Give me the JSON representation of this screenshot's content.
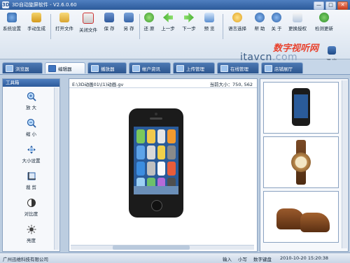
{
  "window": {
    "title": "3D自动旋屏软件 - V2.6.0.60",
    "min": "—",
    "max": "□",
    "close": "✕"
  },
  "toolbar": {
    "items": [
      {
        "label": "系统设置",
        "icon": "system-settings-icon"
      },
      {
        "label": "手动生成",
        "icon": "manual-generate-icon"
      },
      {
        "label": "打开文件",
        "icon": "open-file-icon"
      },
      {
        "label": "关闭文件",
        "icon": "close-file-icon"
      },
      {
        "label": "保",
        "icon": "save-icon"
      },
      {
        "label": "存",
        "icon": "save-icon"
      },
      {
        "label": "另",
        "icon": "save-as-icon"
      },
      {
        "label": "存",
        "icon": "save-as-icon"
      },
      {
        "label": "还",
        "icon": "undo-icon"
      },
      {
        "label": "原",
        "icon": "undo-icon"
      },
      {
        "label": "上一步",
        "icon": "previous-step-icon"
      },
      {
        "label": "下一步",
        "icon": "next-step-icon"
      },
      {
        "label": "预",
        "icon": "preview-icon"
      },
      {
        "label": "览",
        "icon": "preview-icon"
      },
      {
        "label": "语言选择",
        "icon": "language-icon"
      },
      {
        "label": "帮",
        "icon": "help-icon"
      },
      {
        "label": "助",
        "icon": "help-icon"
      },
      {
        "label": "关",
        "icon": "about-icon"
      },
      {
        "label": "于",
        "icon": "about-icon"
      },
      {
        "label": "更换授权",
        "icon": "change-license-icon"
      },
      {
        "label": "检测更新",
        "icon": "check-update-icon"
      }
    ],
    "exit_label": "退 出"
  },
  "brand": {
    "line1": "数字视听网",
    "line2_main": "itavcn",
    "line2_suffix": ".com"
  },
  "tabs": [
    {
      "label": "浏览器",
      "active": false
    },
    {
      "label": "编辑器",
      "active": true
    },
    {
      "label": "播放器",
      "active": false
    },
    {
      "label": "帐户资讯",
      "active": false
    },
    {
      "label": "上传管理",
      "active": false
    },
    {
      "label": "在线管理",
      "active": false
    },
    {
      "label": "店铺展厅",
      "active": false
    }
  ],
  "toolbox": {
    "title": "工具箱",
    "tools": [
      {
        "label": "放 大",
        "icon": "zoom-in-icon"
      },
      {
        "label": "缩 小",
        "icon": "zoom-out-icon"
      },
      {
        "label": "大小设置",
        "icon": "resize-icon"
      },
      {
        "label": "裁 剪",
        "icon": "crop-icon"
      },
      {
        "label": "对比度",
        "icon": "contrast-icon"
      },
      {
        "label": "亮度",
        "icon": "brightness-icon"
      }
    ]
  },
  "editor": {
    "path": "E:\\3D动画01\\(1)动画.gv",
    "size_label": "当前大小：750, 562"
  },
  "gallery": [
    "phone",
    "watch",
    "shoes"
  ],
  "status": {
    "company": "广州迅维科技有限公司",
    "mode1": "输入",
    "mode2": "小写",
    "keyboard": "数字键盘",
    "datetime": "2010-10-20 15:20:38"
  },
  "colors": {
    "title_bar": "#2c5a9a",
    "brand_red": "#e8432f",
    "tab_blue": "#2d568f"
  }
}
